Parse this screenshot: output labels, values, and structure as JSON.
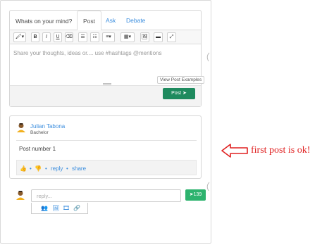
{
  "composer": {
    "prompt": "Whats on your mind?",
    "tabs": [
      {
        "label": "Post",
        "active": true
      },
      {
        "label": "Ask",
        "active": false
      },
      {
        "label": "Debate",
        "active": false
      }
    ],
    "toolbar": {
      "magic": "🖌▾",
      "bold": "B",
      "italic": "I",
      "underline": "U",
      "eraser": "⌫",
      "bullet": "☰",
      "numbered": "☷",
      "align": "≡▾",
      "table": "▦▾",
      "image": "🖼",
      "video": "▬",
      "fullscreen": "⤢"
    },
    "placeholder": "Share your thoughts, ideas or.... use #hashtags @mentions",
    "tooltip": "View Post Examples",
    "post_button": "Post ➤"
  },
  "post": {
    "author": "Julian Tabona",
    "role": "Bachelor",
    "text": "Post number 1",
    "actions": {
      "like_icon": "👍",
      "dislike_icon": "👎",
      "dot": "•",
      "reply": "reply",
      "share": "share"
    }
  },
  "reply": {
    "placeholder": "reply...",
    "send_label": "➤139",
    "tools": {
      "user": "👥",
      "image": "🖼",
      "film": "🎞",
      "link": "🔗"
    }
  },
  "annotation": {
    "text": "first post is ok!"
  },
  "colors": {
    "accent": "#3a8dde",
    "post_button": "#1e8a5e",
    "send_button": "#2db36e",
    "annotation": "#e02020"
  }
}
